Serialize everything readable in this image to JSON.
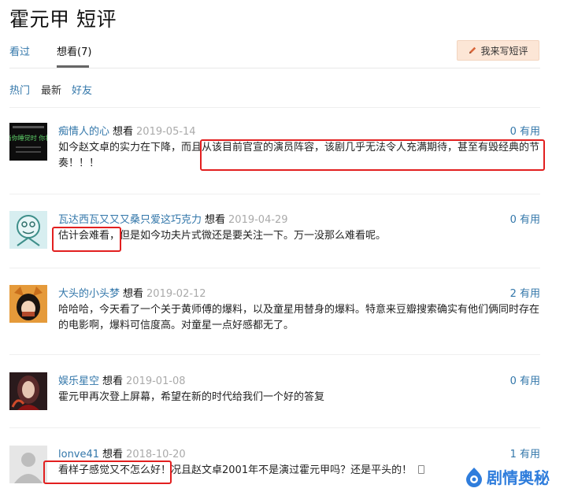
{
  "page": {
    "title": "霍元甲 短评"
  },
  "tabs": {
    "seen": "看过",
    "want": "想看(7)"
  },
  "write_review": {
    "label": "我来写短评"
  },
  "filters": {
    "hot": "热门",
    "new": "最新",
    "friends": "好友"
  },
  "comments": [
    {
      "user": "痴情人的心",
      "rating": "想看",
      "date": "2019-05-14",
      "votes": "0 有用",
      "text": "如今赵文卓的实力在下降，而且从该目前官宣的演员阵容，该剧几乎无法令人充满期待，甚至有毁经典的节奏！！！",
      "avatar_caption": "当你睡觉时 你将"
    },
    {
      "user": "瓦达西瓦又又又桑只爱这巧克力",
      "rating": "想看",
      "date": "2019-04-29",
      "votes": "0 有用",
      "text": "估计会难看，但是如今功夫片式微还是要关注一下。万一没那么难看呢。"
    },
    {
      "user": "大头的小头梦",
      "rating": "想看",
      "date": "2019-02-12",
      "votes": "2 有用",
      "text": "哈哈哈，今天看了一个关于黄师傅的爆料，以及童星用替身的爆料。特意来豆瓣搜索确实有他们俩同时存在的电影啊，爆料可信度高。对童星一点好感都无了。"
    },
    {
      "user": "娱乐星空",
      "rating": "想看",
      "date": "2019-01-08",
      "votes": "0 有用",
      "text": "霍元甲再次登上屏幕，希望在新的时代给我们一个好的答复"
    },
    {
      "user": "lonve41",
      "rating": "想看",
      "date": "2018-10-20",
      "votes": "1 有用",
      "text": "看样子感觉又不怎么好！况且赵文卓2001年不是演过霍元甲吗？还是平头的！"
    }
  ],
  "watermark": {
    "text": "剧情奥秘"
  },
  "colors": {
    "link": "#3377aa",
    "highlight": "#e21f1f",
    "button_bg": "#fce6d6",
    "watermark": "#2f7ddc"
  }
}
